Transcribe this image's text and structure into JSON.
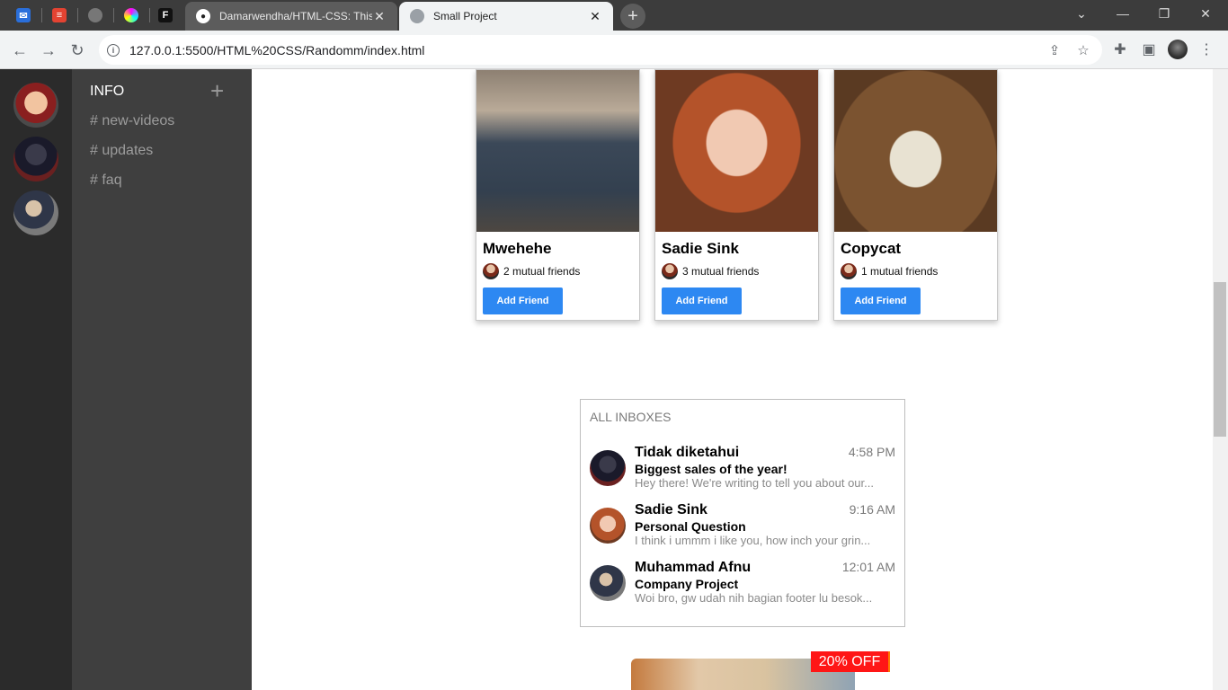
{
  "browser": {
    "tabs": [
      {
        "title": "Damarwendha/HTML-CSS: This r",
        "favicon": "github-icon"
      },
      {
        "title": "Small Project",
        "favicon": "globe-icon"
      }
    ],
    "url": "127.0.0.1:5500/HTML%20CSS/Randomm/index.html",
    "pinned_tabs": [
      "mail-icon",
      "todoist-icon",
      "circle-icon",
      "colorful-icon",
      "framer-icon"
    ]
  },
  "sidebar": {
    "heading": "INFO",
    "add_icon": "plus-icon",
    "channels": [
      "# new-videos",
      "# updates",
      "# faq"
    ]
  },
  "cards": [
    {
      "name": "Mwehehe",
      "mutual": "2 mutual friends",
      "button": "Add Friend"
    },
    {
      "name": "Sadie Sink",
      "mutual": "3 mutual friends",
      "button": "Add Friend"
    },
    {
      "name": "Copycat",
      "mutual": "1 mutual friends",
      "button": "Add Friend"
    }
  ],
  "inbox": {
    "title": "ALL INBOXES",
    "messages": [
      {
        "sender": "Tidak diketahui",
        "time": "4:58 PM",
        "subject": "Biggest sales of the year!",
        "preview": "Hey there! We're writing to tell you about our..."
      },
      {
        "sender": "Sadie Sink",
        "time": "9:16 AM",
        "subject": "Personal Question",
        "preview": "I think i ummm i like you, how inch your grin..."
      },
      {
        "sender": "Muhammad Afnu",
        "time": "12:01 AM",
        "subject": "Company Project",
        "preview": "Woi bro, gw udah nih bagian footer lu besok..."
      }
    ]
  },
  "product": {
    "badge": "20% OFF"
  },
  "colors": {
    "accent": "#2d88f2",
    "rail": "#2b2b2b",
    "panel": "#3f3f3f",
    "badge": "#ff1616"
  }
}
